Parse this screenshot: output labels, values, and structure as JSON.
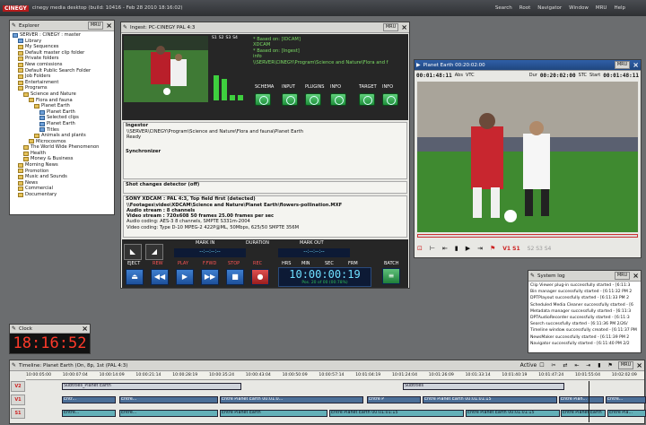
{
  "desktop": {
    "logo": "CINEGY",
    "title": "cinegy media desktop (build: 10416 - Feb 28 2010 18:16:02)",
    "menu": [
      "Search",
      "Root",
      "Navigator",
      "Window",
      "MRU",
      "Help"
    ]
  },
  "explorer": {
    "title": "Explorer",
    "mru": "MRU",
    "server": "SERVER : CINEGY : master",
    "items": [
      {
        "label": "Library",
        "indent": 1,
        "icon": "b"
      },
      {
        "label": "My Sequences",
        "indent": 1
      },
      {
        "label": "Default master clip folder",
        "indent": 1
      },
      {
        "label": "Private folders",
        "indent": 1
      },
      {
        "label": "New comissions",
        "indent": 1
      },
      {
        "label": "Default Public Search Folder",
        "indent": 1
      },
      {
        "label": "Job Folders",
        "indent": 1
      },
      {
        "label": "Entertainment",
        "indent": 1
      },
      {
        "label": "Programs",
        "indent": 1
      },
      {
        "label": "Science and Nature",
        "indent": 2
      },
      {
        "label": "Flora and fauna",
        "indent": 3
      },
      {
        "label": "Planet Earth",
        "indent": 4
      },
      {
        "label": "Planet Earth",
        "indent": 5,
        "icon": "b"
      },
      {
        "label": "Selected clips",
        "indent": 5,
        "icon": "b"
      },
      {
        "label": "Planet Earth",
        "indent": 5,
        "icon": "b"
      },
      {
        "label": "Titles",
        "indent": 5,
        "icon": "b"
      },
      {
        "label": "Animals and plants",
        "indent": 4
      },
      {
        "label": "Microcosmos",
        "indent": 3
      },
      {
        "label": "The World Wide Phenomenon",
        "indent": 2
      },
      {
        "label": "Health",
        "indent": 2
      },
      {
        "label": "Money & Business",
        "indent": 2
      },
      {
        "label": "Morning News",
        "indent": 1
      },
      {
        "label": "Promotion",
        "indent": 1
      },
      {
        "label": "Music and Sounds",
        "indent": 1
      },
      {
        "label": "News",
        "indent": 1
      },
      {
        "label": "Commercial",
        "indent": 1
      },
      {
        "label": "Documentary",
        "indent": 1
      }
    ]
  },
  "ingest": {
    "title": "Ingest: PC-CINEGY PAL 4:3",
    "mru": "MRU",
    "meters": [
      "S1",
      "S2",
      "S3",
      "S4"
    ],
    "info_lines": [
      "* Based on: [IDCAM]",
      "XDCAM",
      "* Based on: [Ingest]",
      "info",
      "\\\\SERVER\\CINEGY\\Program\\Science and Nature\\Flora and f"
    ],
    "tabs": [
      "SCHEMA",
      "INPUT",
      "PLUGINS",
      "INFO",
      "TARGET",
      "INFO"
    ],
    "ingestor": {
      "title": "Ingestor",
      "path": "\\\\SERVER\\CINEGY\\Program\\Science and Nature\\Flora and fauna\\Planet Earth",
      "status": "Ready"
    },
    "synchronizer": "Synchronizer",
    "shot_changes": "Shot changes detector (off)",
    "source": {
      "title": "SONY XDCAM : PAL 4:3, Top field first (detected)",
      "lines": [
        "\\\\Footages\\video\\XDCAM\\Science and Nature\\Planet Earth\\flowers-pollination.MXF",
        "Audio stream : 8 channels",
        "Video stream : 720x608 50 frames 25.00 frames per sec",
        "Audio coding: AES-3 8 channels, SMPTE S331m-2004",
        "Video coding: Type D-10 MPEG-2 422P@ML, 50Mbps, 625/50 SMPTE 356M"
      ]
    },
    "mark_in": "MARK IN",
    "duration": "DURATION",
    "mark_out": "MARK OUT",
    "tc_placeholder": "--:--:--:--",
    "transport": [
      "EJECT",
      "REW",
      "PLAY",
      "F.FWD",
      "STOP",
      "REC"
    ],
    "tc_labels": [
      "HRS",
      "MIN",
      "SEC",
      "FRM"
    ],
    "batch": "BATCH",
    "big_tc": "10:00:00:19",
    "big_tc_sub": "Pos. 20 of 00 (00:78%)"
  },
  "player": {
    "title": "Planet Earth 00:20:02:00",
    "mru": "MRU",
    "tc_left": "00:01:48:11",
    "abs": "Abs",
    "vtc": "VTC",
    "dur_label": "Dur",
    "dur": "00:20:02:00",
    "stc": "STC",
    "start_label": "Start",
    "tc_right": "00:01:48:11",
    "tracks": "V1 S1",
    "audio": "S2 S3 S4"
  },
  "syslog": {
    "title": "System log",
    "mru": "MRU",
    "lines": [
      "Clip Viewer plug-in successfully started - [6:11:3",
      "Bin manager successfully started - [6:11:32 PM 2",
      "DPTPlayout successfully started - [6:11:33 PM 2",
      "Scheduled Media Cleaner successfully started - [6",
      "Metadata manager successfully started - [6:11:3",
      "DPTAudioRecorder successfully started - [6:11:3",
      "Search successfully started - [6:11:36 PM 2/26/",
      "Timeline window successfully created - [6:11:37 PM",
      "NewsMaker successfully started - [6:11:39 PM 2",
      "Navigator successfully started - [6:11:40 PM 2/2"
    ]
  },
  "clock": {
    "title": "Clock",
    "time": "18:16:52"
  },
  "timeline": {
    "title": "Timeline: Planet Earth (On, 8p, 1st (PAL 4:3)",
    "active": "Active",
    "mru": "MRU",
    "ruler": [
      "10:00:05:00",
      "10:00:07:04",
      "10:00:14:09",
      "10:00:21:14",
      "10:00:28:19",
      "10:00:35:24",
      "10:00:43:04",
      "10:00:50:09",
      "10:00:57:14",
      "10:01:04:19",
      "10:01:24:04",
      "10:01:26:09",
      "10:01:33:14",
      "10:01:40:19",
      "10:01:47:24",
      "10:01:55:04",
      "10:02:02:09"
    ],
    "tracks": [
      "V2",
      "V1",
      "S1"
    ],
    "v2_clips": [
      "Subtitles_Planet Earth",
      "Subtitles"
    ],
    "v1_clips": [
      "Entr...",
      "Entre...",
      "Entre Planet Earth 00:01:0...",
      "Entre P",
      "Entre Planet Earth 00:01:01:15",
      "Entre Plan...",
      "Entre..."
    ],
    "s1_clips": [
      "Entre...",
      "Entre...",
      "Entre Planet Earth",
      "Entre Planet Earth 00:01:01:15",
      "Entre Planet Earth 00:01:01:15",
      "Entre Planet Earth",
      "Entre Pla..."
    ]
  },
  "colors": {
    "desktop": "#6b6d6f",
    "title_blue": "#2f5fa8",
    "clock_red": "#ff3a2a",
    "tc_cyan": "#6fe0ff"
  }
}
